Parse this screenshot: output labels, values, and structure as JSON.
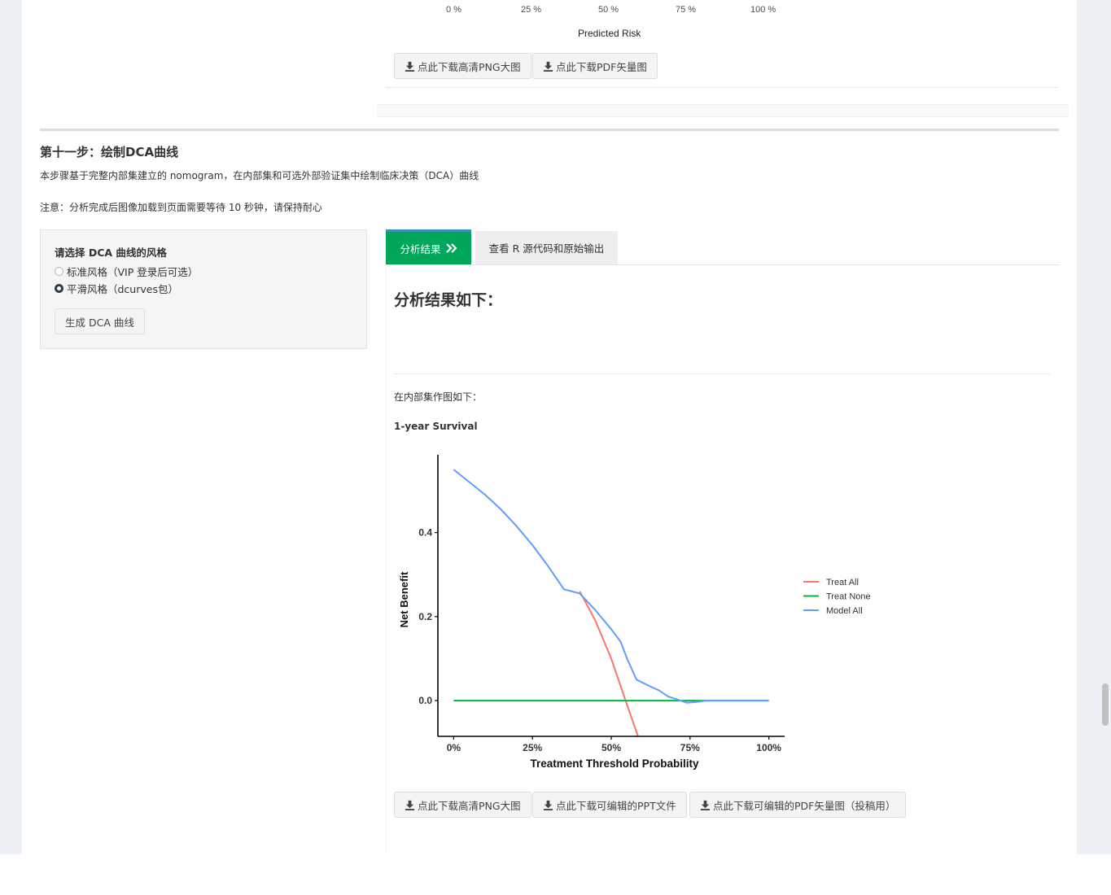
{
  "top_chart": {
    "x_ticks": [
      "0 %",
      "25 %",
      "50 %",
      "75 %",
      "100 %"
    ],
    "x_title": "Predicted Risk"
  },
  "top_buttons": {
    "png": "点此下载高清PNG大图",
    "pdf": "点此下载PDF矢量图"
  },
  "step": {
    "title": "第十一步：绘制DCA曲线",
    "description": "本步骤基于完整内部集建立的 nomogram，在内部集和可选外部验证集中绘制临床决策（DCA）曲线",
    "note": "注意：分析完成后图像加载到页面需要等待 10 秒钟，请保持耐心"
  },
  "options_panel": {
    "title": "请选择 DCA 曲线的风格",
    "radio_options": [
      {
        "label": "标准风格（VIP 登录后可选）",
        "selected": false
      },
      {
        "label": "平滑风格（dcurves包）",
        "selected": true
      }
    ],
    "generate_button": "生成 DCA 曲线"
  },
  "tabs": {
    "results": "分析结果",
    "results_icon": "double-chevron-right-icon",
    "source": "查看 R 源代码和原始输出"
  },
  "results": {
    "heading": "分析结果如下：",
    "internal_label": "在内部集作图如下：",
    "survival_label": "1-year Survival"
  },
  "chart_data": {
    "type": "line",
    "title": "",
    "xlabel": "Treatment Threshold Probability",
    "ylabel": "Net Benefit",
    "x_tick_labels": [
      "0%",
      "25%",
      "50%",
      "75%",
      "100%"
    ],
    "y_tick_labels": [
      "0.0",
      "0.2",
      "0.4"
    ],
    "xlim": [
      -0.05,
      1.05
    ],
    "ylim": [
      -0.085,
      0.585
    ],
    "legend_position": "right",
    "series": [
      {
        "name": "Treat All",
        "color": "#f8766d",
        "x": [
          0.4,
          0.45,
          0.5,
          0.55,
          0.585
        ],
        "y": [
          0.26,
          0.19,
          0.1,
          -0.01,
          -0.085
        ]
      },
      {
        "name": "Treat None",
        "color": "#00ba38",
        "x": [
          0.0,
          1.0
        ],
        "y": [
          0.0,
          0.0
        ]
      },
      {
        "name": "Model All",
        "color": "#619cff",
        "x": [
          0.0,
          0.05,
          0.1,
          0.15,
          0.2,
          0.25,
          0.3,
          0.35,
          0.4,
          0.45,
          0.5,
          0.53,
          0.55,
          0.58,
          0.62,
          0.65,
          0.68,
          0.72,
          0.74,
          0.77,
          0.8,
          0.85,
          0.9,
          0.95,
          1.0
        ],
        "y": [
          0.55,
          0.52,
          0.49,
          0.455,
          0.415,
          0.37,
          0.32,
          0.265,
          0.255,
          0.215,
          0.17,
          0.14,
          0.1,
          0.05,
          0.035,
          0.025,
          0.01,
          0.0,
          -0.005,
          -0.003,
          0.0,
          0.0,
          0.0,
          0.0,
          0.0
        ]
      }
    ]
  },
  "bottom_buttons": {
    "png": "点此下载高清PNG大图",
    "ppt": "点此下载可编辑的PPT文件",
    "pdf": "点此下载可编辑的PDF矢量图（投稿用）"
  },
  "icons": {
    "download": "download-icon"
  }
}
